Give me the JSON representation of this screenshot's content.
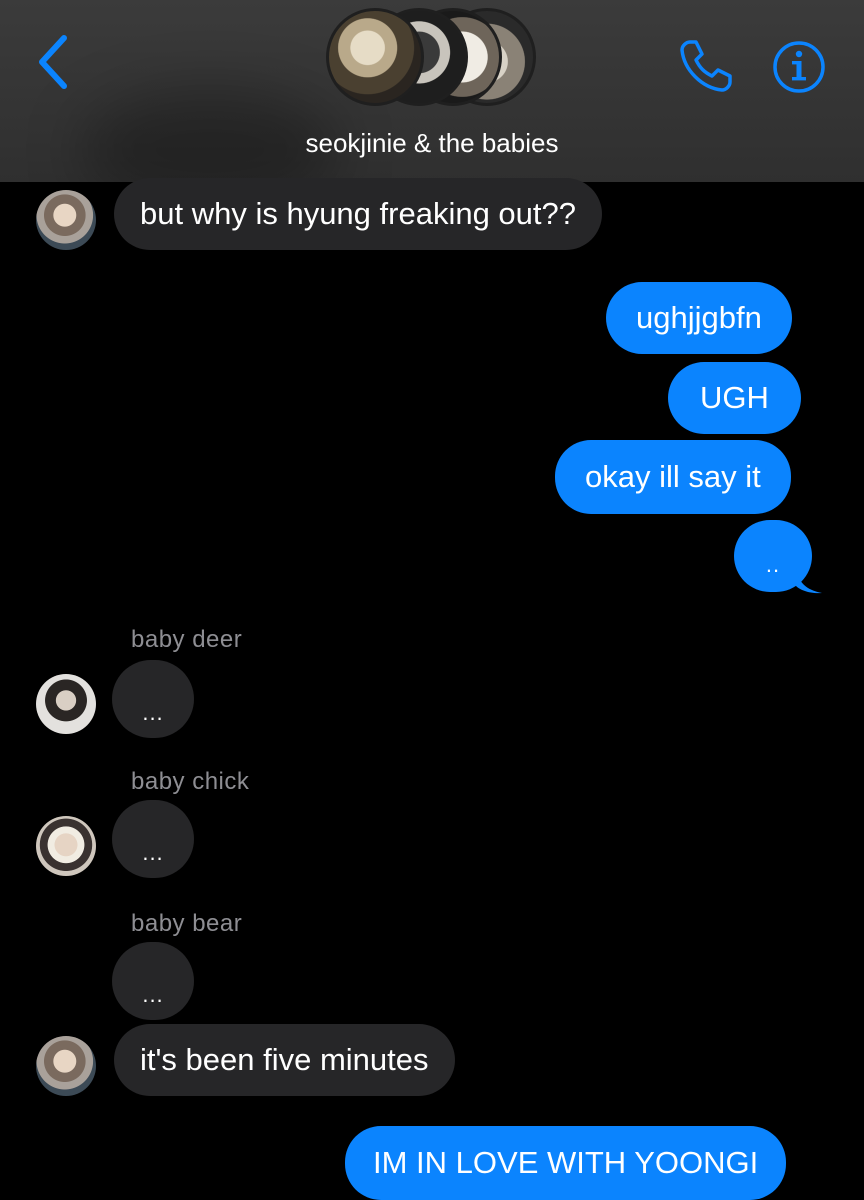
{
  "header": {
    "group_name": "seokjinie & the babies",
    "back_icon": "chevron-left-icon",
    "call_icon": "phone-icon",
    "info_icon": "info-icon",
    "accent_color": "#0b84fe"
  },
  "messages": [
    {
      "direction": "incoming",
      "text": "but why is hyung freaking out??"
    },
    {
      "direction": "outgoing",
      "text": "ughjjgbfn"
    },
    {
      "direction": "outgoing",
      "text": "UGH"
    },
    {
      "direction": "outgoing",
      "text": "okay ill say it"
    },
    {
      "direction": "outgoing",
      "text": ".."
    },
    {
      "direction": "incoming",
      "sender": "baby deer",
      "text": "..."
    },
    {
      "direction": "incoming",
      "sender": "baby chick",
      "text": "..."
    },
    {
      "direction": "incoming",
      "sender": "baby bear",
      "text": "..."
    },
    {
      "direction": "incoming",
      "text": "it's been five minutes"
    },
    {
      "direction": "outgoing",
      "text": "IM IN LOVE WITH YOONGI"
    }
  ],
  "colors": {
    "incoming_bubble": "#262628",
    "outgoing_bubble": "#0b84fe",
    "sender_label": "#8e8e93",
    "background": "#000000"
  }
}
